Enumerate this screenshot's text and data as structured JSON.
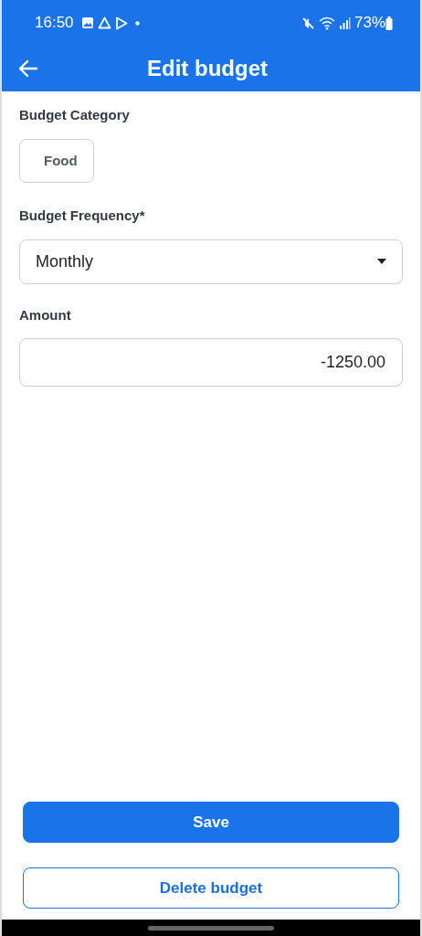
{
  "status_bar": {
    "time": "16:50",
    "battery": "73%"
  },
  "app_bar": {
    "title": "Edit budget"
  },
  "form": {
    "category_label": "Budget Category",
    "category": "Food",
    "frequency_label": "Budget Frequency*",
    "frequency": "Monthly",
    "amount_label": "Amount",
    "amount": "-1250.00"
  },
  "buttons": [
    {
      "kind": "primary",
      "label": "Save"
    },
    {
      "kind": "outline",
      "label": "Delete budget"
    }
  ]
}
